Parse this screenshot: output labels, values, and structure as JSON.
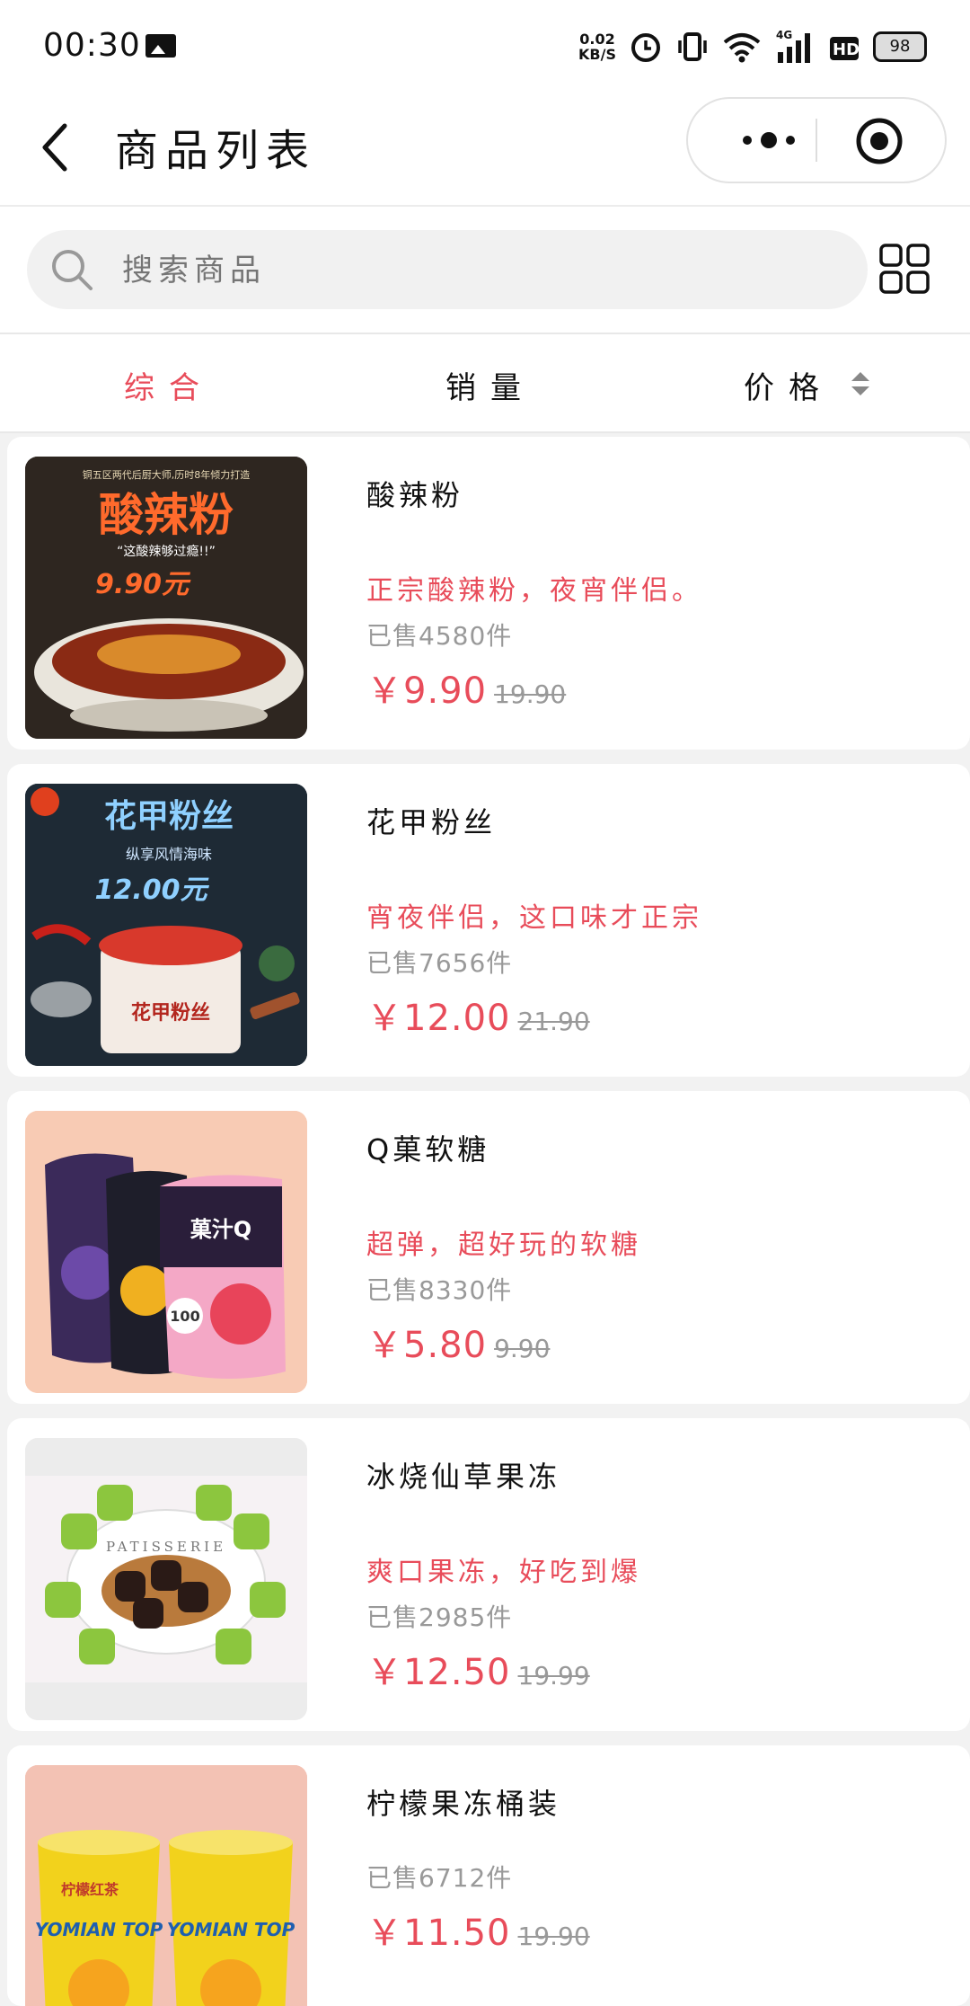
{
  "status": {
    "time": "00:30",
    "net_speed_value": "0.02",
    "net_speed_unit": "KB/S",
    "network": "4G",
    "hd": "HD",
    "battery": "98",
    "icons": [
      "image-icon",
      "alarm-icon",
      "vibrate-icon",
      "wifi-icon",
      "signal-icon",
      "hd-icon",
      "battery-icon"
    ]
  },
  "nav": {
    "title": "商品列表"
  },
  "search": {
    "placeholder": "搜索商品"
  },
  "tabs": [
    {
      "label": "综合",
      "active": true
    },
    {
      "label": "销量",
      "active": false
    },
    {
      "label": "价格",
      "active": false
    }
  ],
  "products": [
    {
      "name": "酸辣粉",
      "desc": "正宗酸辣粉，夜宵伴侣。",
      "sold": "已售4580件",
      "price": "￥9.90",
      "orig": "19.90",
      "thumb": {
        "banner": "铜五区两代后厨大师,历时8年倾力打造",
        "title": "酸辣粉",
        "slogan": "“这酸辣够过瘾!!”",
        "price": "9.90元"
      }
    },
    {
      "name": "花甲粉丝",
      "desc": "宵夜伴侣，这口味才正宗",
      "sold": "已售7656件",
      "price": "￥12.00",
      "orig": "21.90",
      "thumb": {
        "title": "花甲粉丝",
        "slogan": "纵享风情海味",
        "price": "12.00元",
        "cup": "花甲粉丝"
      }
    },
    {
      "name": "Q菓软糖",
      "desc": "超弹，超好玩的软糖",
      "sold": "已售8330件",
      "price": "￥5.80",
      "orig": "9.90",
      "thumb": {
        "pack": "菓汁Q",
        "badge": "100"
      }
    },
    {
      "name": "冰烧仙草果冻",
      "desc": "爽口果冻，好吃到爆",
      "sold": "已售2985件",
      "price": "￥12.50",
      "orig": "19.99",
      "thumb": {
        "plate": "PATISSERIE"
      }
    },
    {
      "name": "柠檬果冻桶装",
      "desc": "",
      "sold": "已售6712件",
      "price": "￥11.50",
      "orig": "19.90",
      "thumb": {
        "cup": "柠檬红茶",
        "brand": "YOMIAN TOP"
      }
    }
  ],
  "colors": {
    "accent": "#e84c5a",
    "muted": "#999999",
    "bg": "#f2f2f2"
  }
}
